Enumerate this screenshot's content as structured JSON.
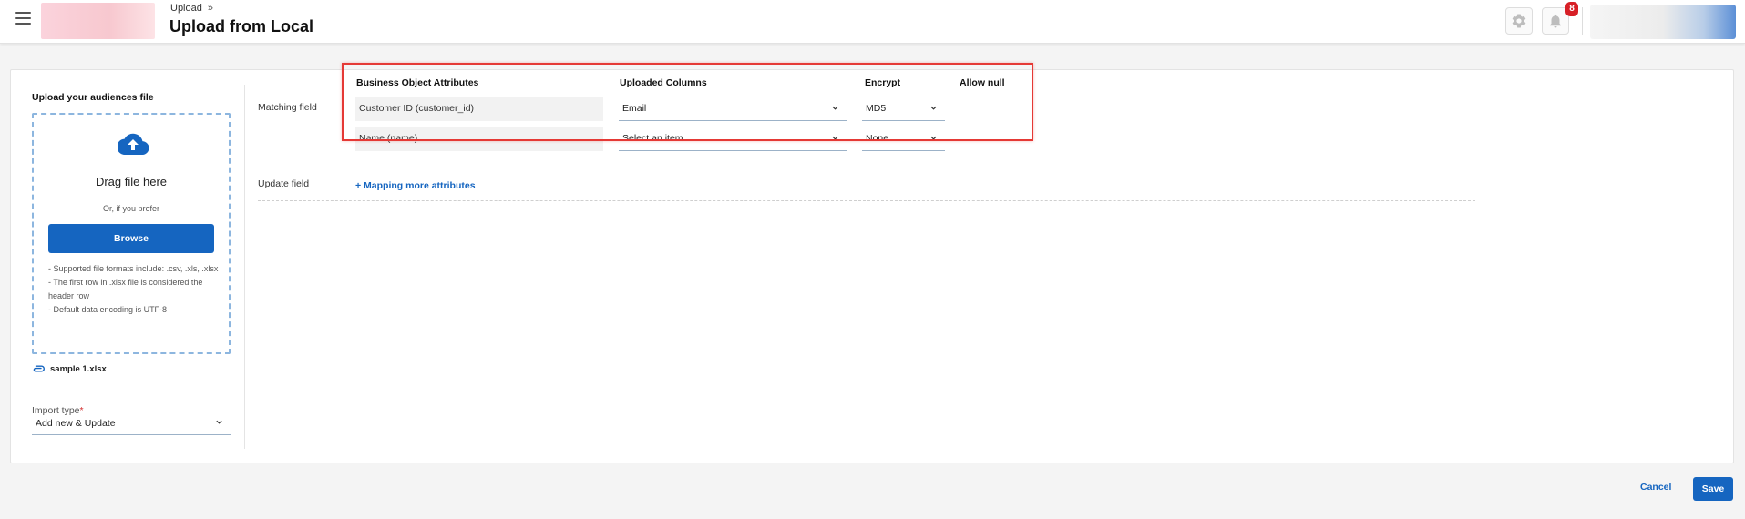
{
  "header": {
    "breadcrumb": "Upload",
    "breadcrumb_sep": "»",
    "title": "Upload from Local",
    "notification_count": "8"
  },
  "upload": {
    "title": "Upload your audiences file",
    "drag_text": "Drag file here",
    "or_text": "Or, if you prefer",
    "browse_label": "Browse",
    "notes": [
      "- Supported file formats include: .csv, .xls, .xlsx",
      "- The first row in .xlsx file is considered the header row",
      "- Default data encoding is UTF-8"
    ],
    "file_name": "sample 1.xlsx",
    "import_type_label": "Import type",
    "import_type_required": "*",
    "import_type_value": "Add new & Update"
  },
  "mapping": {
    "headers": {
      "attributes": "Business Object Attributes",
      "columns": "Uploaded Columns",
      "encrypt": "Encrypt",
      "allow_null": "Allow null"
    },
    "matching_label": "Matching field",
    "update_label": "Update field",
    "rows": [
      {
        "attribute": "Customer ID (customer_id)",
        "column": "Email",
        "encrypt": "MD5"
      },
      {
        "attribute": "Name (name)",
        "column": "Select an item",
        "encrypt": "None"
      }
    ],
    "more_link": "+ Mapping more attributes"
  },
  "footer": {
    "cancel_label": "Cancel",
    "save_label": "Save"
  },
  "colors": {
    "primary": "#1565c0",
    "highlight": "#e53935",
    "badge": "#d71f26"
  }
}
